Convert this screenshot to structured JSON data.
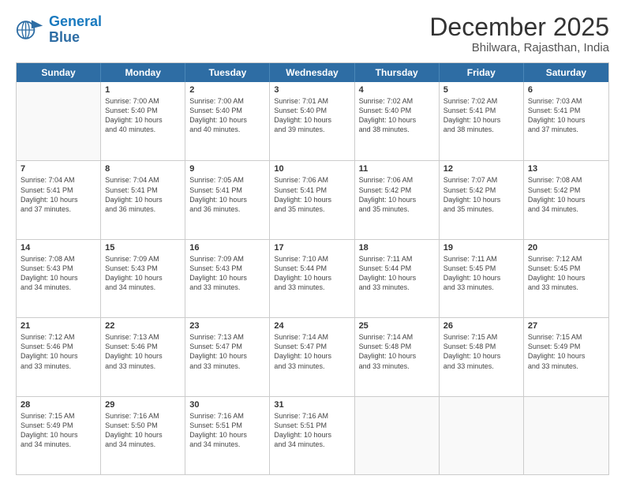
{
  "logo": {
    "line1": "General",
    "line2": "Blue"
  },
  "title": "December 2025",
  "location": "Bhilwara, Rajasthan, India",
  "days_of_week": [
    "Sunday",
    "Monday",
    "Tuesday",
    "Wednesday",
    "Thursday",
    "Friday",
    "Saturday"
  ],
  "weeks": [
    [
      {
        "day": "",
        "info": ""
      },
      {
        "day": "1",
        "info": "Sunrise: 7:00 AM\nSunset: 5:40 PM\nDaylight: 10 hours\nand 40 minutes."
      },
      {
        "day": "2",
        "info": "Sunrise: 7:00 AM\nSunset: 5:40 PM\nDaylight: 10 hours\nand 40 minutes."
      },
      {
        "day": "3",
        "info": "Sunrise: 7:01 AM\nSunset: 5:40 PM\nDaylight: 10 hours\nand 39 minutes."
      },
      {
        "day": "4",
        "info": "Sunrise: 7:02 AM\nSunset: 5:40 PM\nDaylight: 10 hours\nand 38 minutes."
      },
      {
        "day": "5",
        "info": "Sunrise: 7:02 AM\nSunset: 5:41 PM\nDaylight: 10 hours\nand 38 minutes."
      },
      {
        "day": "6",
        "info": "Sunrise: 7:03 AM\nSunset: 5:41 PM\nDaylight: 10 hours\nand 37 minutes."
      }
    ],
    [
      {
        "day": "7",
        "info": "Sunrise: 7:04 AM\nSunset: 5:41 PM\nDaylight: 10 hours\nand 37 minutes."
      },
      {
        "day": "8",
        "info": "Sunrise: 7:04 AM\nSunset: 5:41 PM\nDaylight: 10 hours\nand 36 minutes."
      },
      {
        "day": "9",
        "info": "Sunrise: 7:05 AM\nSunset: 5:41 PM\nDaylight: 10 hours\nand 36 minutes."
      },
      {
        "day": "10",
        "info": "Sunrise: 7:06 AM\nSunset: 5:41 PM\nDaylight: 10 hours\nand 35 minutes."
      },
      {
        "day": "11",
        "info": "Sunrise: 7:06 AM\nSunset: 5:42 PM\nDaylight: 10 hours\nand 35 minutes."
      },
      {
        "day": "12",
        "info": "Sunrise: 7:07 AM\nSunset: 5:42 PM\nDaylight: 10 hours\nand 35 minutes."
      },
      {
        "day": "13",
        "info": "Sunrise: 7:08 AM\nSunset: 5:42 PM\nDaylight: 10 hours\nand 34 minutes."
      }
    ],
    [
      {
        "day": "14",
        "info": "Sunrise: 7:08 AM\nSunset: 5:43 PM\nDaylight: 10 hours\nand 34 minutes."
      },
      {
        "day": "15",
        "info": "Sunrise: 7:09 AM\nSunset: 5:43 PM\nDaylight: 10 hours\nand 34 minutes."
      },
      {
        "day": "16",
        "info": "Sunrise: 7:09 AM\nSunset: 5:43 PM\nDaylight: 10 hours\nand 33 minutes."
      },
      {
        "day": "17",
        "info": "Sunrise: 7:10 AM\nSunset: 5:44 PM\nDaylight: 10 hours\nand 33 minutes."
      },
      {
        "day": "18",
        "info": "Sunrise: 7:11 AM\nSunset: 5:44 PM\nDaylight: 10 hours\nand 33 minutes."
      },
      {
        "day": "19",
        "info": "Sunrise: 7:11 AM\nSunset: 5:45 PM\nDaylight: 10 hours\nand 33 minutes."
      },
      {
        "day": "20",
        "info": "Sunrise: 7:12 AM\nSunset: 5:45 PM\nDaylight: 10 hours\nand 33 minutes."
      }
    ],
    [
      {
        "day": "21",
        "info": "Sunrise: 7:12 AM\nSunset: 5:46 PM\nDaylight: 10 hours\nand 33 minutes."
      },
      {
        "day": "22",
        "info": "Sunrise: 7:13 AM\nSunset: 5:46 PM\nDaylight: 10 hours\nand 33 minutes."
      },
      {
        "day": "23",
        "info": "Sunrise: 7:13 AM\nSunset: 5:47 PM\nDaylight: 10 hours\nand 33 minutes."
      },
      {
        "day": "24",
        "info": "Sunrise: 7:14 AM\nSunset: 5:47 PM\nDaylight: 10 hours\nand 33 minutes."
      },
      {
        "day": "25",
        "info": "Sunrise: 7:14 AM\nSunset: 5:48 PM\nDaylight: 10 hours\nand 33 minutes."
      },
      {
        "day": "26",
        "info": "Sunrise: 7:15 AM\nSunset: 5:48 PM\nDaylight: 10 hours\nand 33 minutes."
      },
      {
        "day": "27",
        "info": "Sunrise: 7:15 AM\nSunset: 5:49 PM\nDaylight: 10 hours\nand 33 minutes."
      }
    ],
    [
      {
        "day": "28",
        "info": "Sunrise: 7:15 AM\nSunset: 5:49 PM\nDaylight: 10 hours\nand 34 minutes."
      },
      {
        "day": "29",
        "info": "Sunrise: 7:16 AM\nSunset: 5:50 PM\nDaylight: 10 hours\nand 34 minutes."
      },
      {
        "day": "30",
        "info": "Sunrise: 7:16 AM\nSunset: 5:51 PM\nDaylight: 10 hours\nand 34 minutes."
      },
      {
        "day": "31",
        "info": "Sunrise: 7:16 AM\nSunset: 5:51 PM\nDaylight: 10 hours\nand 34 minutes."
      },
      {
        "day": "",
        "info": ""
      },
      {
        "day": "",
        "info": ""
      },
      {
        "day": "",
        "info": ""
      }
    ]
  ]
}
